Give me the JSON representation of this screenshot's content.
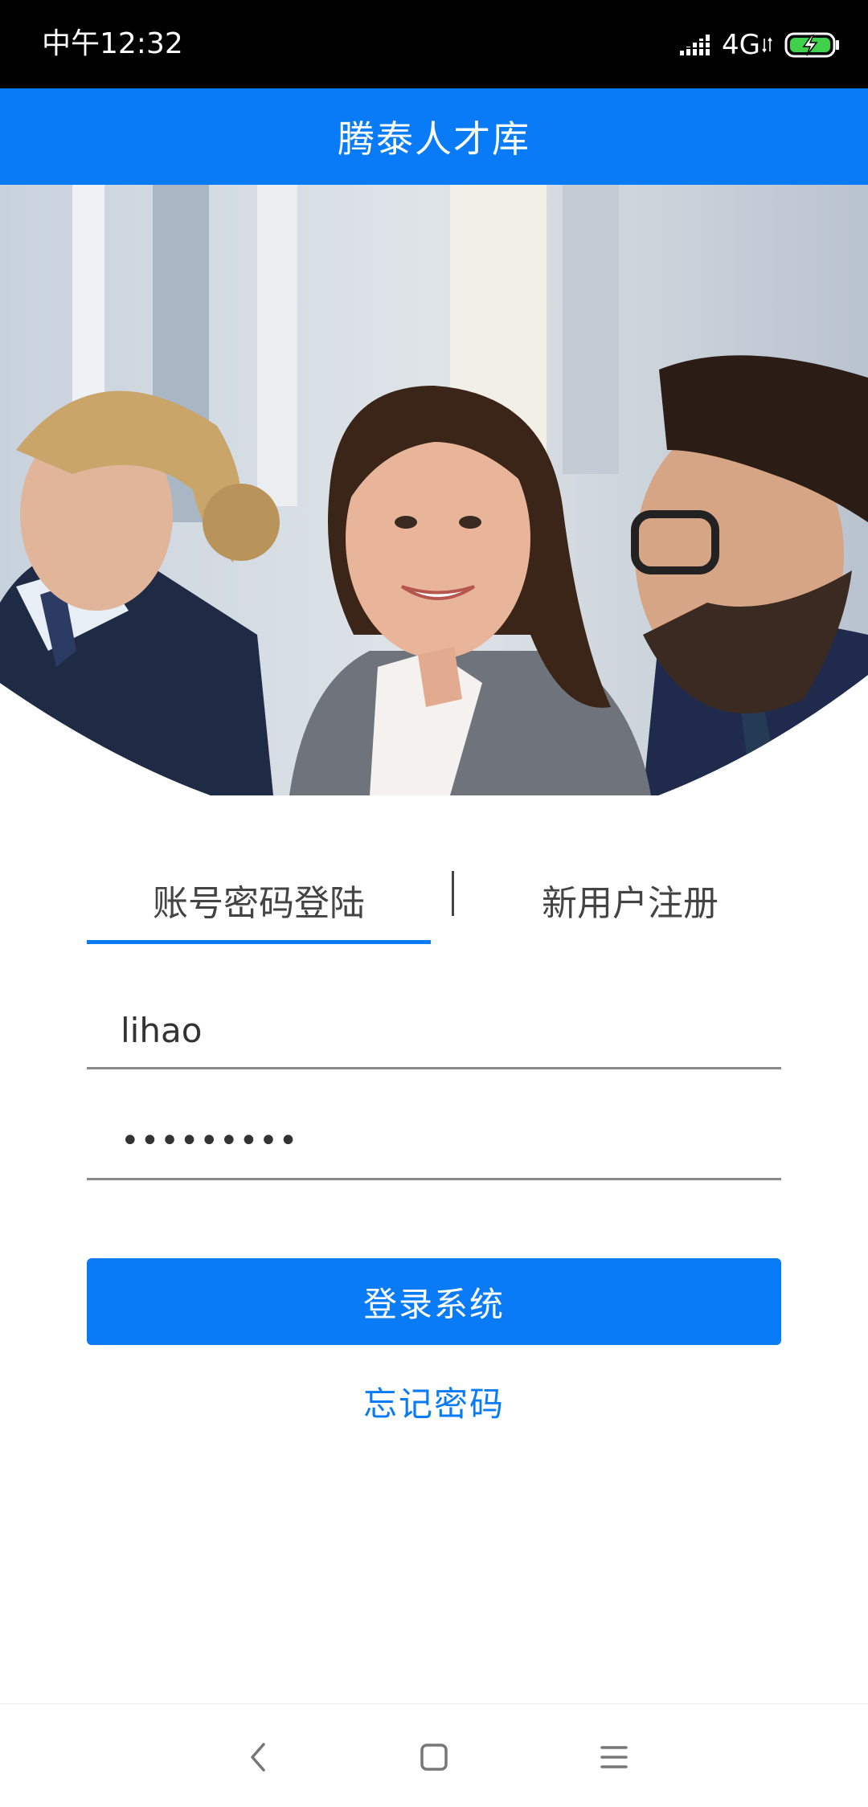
{
  "status_bar": {
    "time": "中午12:32",
    "network": "4G",
    "icons": [
      "signal-icon",
      "network-arrows-icon",
      "battery-charging-icon"
    ]
  },
  "header": {
    "title": "腾泰人才库"
  },
  "hero": {
    "image": "business-people-photo"
  },
  "tabs": {
    "login_label": "账号密码登陆",
    "register_label": "新用户注册",
    "active": "login"
  },
  "form": {
    "username_value": "lihao",
    "password_value": "•••••••••"
  },
  "login_button": {
    "label": "登录系统"
  },
  "forgot_password": {
    "label": "忘记密码"
  },
  "nav_bar": {
    "icons": [
      "back-icon",
      "home-icon",
      "menu-icon"
    ]
  },
  "colors": {
    "accent": "#0a7bf6",
    "status_bar_bg": "#000000",
    "text_primary": "#444444"
  }
}
